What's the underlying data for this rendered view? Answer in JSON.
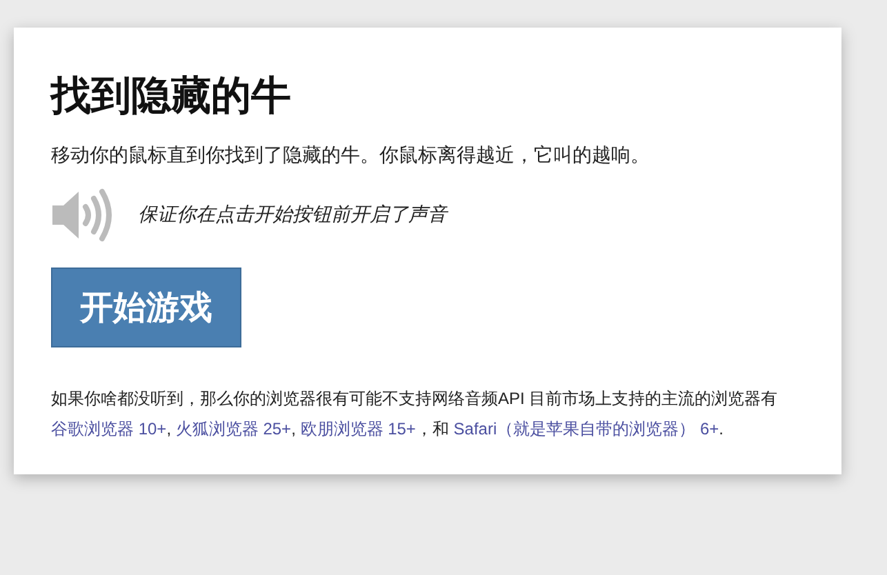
{
  "title": "找到隐藏的牛",
  "intro": "移动你的鼠标直到你找到了隐藏的牛。你鼠标离得越近，它叫的越响。",
  "sound_note": "保证你在点击开始按钮前开启了声音",
  "start_button": "开始游戏",
  "footnote": [
    {
      "kind": "text",
      "text": "如果你啥都没听到，那么你的浏览器很有可能不支持网络音频API 目前市场上支持的主流的浏览器有"
    },
    {
      "kind": "link",
      "text": "谷歌浏览器 10+"
    },
    {
      "kind": "text",
      "text": ", "
    },
    {
      "kind": "link",
      "text": "火狐浏览器 25+"
    },
    {
      "kind": "text",
      "text": ", "
    },
    {
      "kind": "link",
      "text": "欧朋浏览器 15+"
    },
    {
      "kind": "text",
      "text": "，和 "
    },
    {
      "kind": "link",
      "text": "Safari（就是苹果自带的浏览器） 6+"
    },
    {
      "kind": "text",
      "text": "."
    }
  ]
}
